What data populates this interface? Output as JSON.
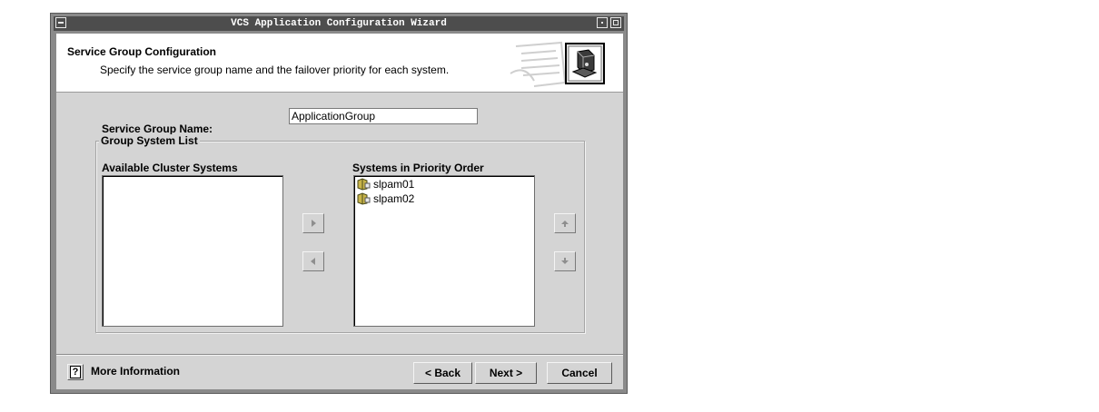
{
  "window": {
    "title": "VCS Application Configuration Wizard"
  },
  "header": {
    "title": "Service Group Configuration",
    "subtitle": "Specify the service group name and the failover priority for each system.",
    "icon": "server-computer-icon"
  },
  "form": {
    "service_group_label": "Service Group Name:",
    "service_group_value": "ApplicationGroup"
  },
  "group_system_list": {
    "legend": "Group System List",
    "available_label": "Available Cluster Systems",
    "available_systems": [],
    "priority_label": "Systems in Priority Order",
    "priority_systems": [
      "slpam01",
      "slpam02"
    ],
    "buttons": {
      "add": "right-arrow-icon",
      "remove": "left-arrow-icon",
      "move_up": "up-arrow-icon",
      "move_down": "down-arrow-icon"
    }
  },
  "footer": {
    "help_icon": "?",
    "more_info_label": "More Information",
    "back_label": "< Back",
    "next_label": "Next >",
    "cancel_label": "Cancel"
  },
  "colors": {
    "titlebar": "#4d4d4d",
    "dialog_bg": "#d4d4d4",
    "header_bg": "#ffffff"
  }
}
